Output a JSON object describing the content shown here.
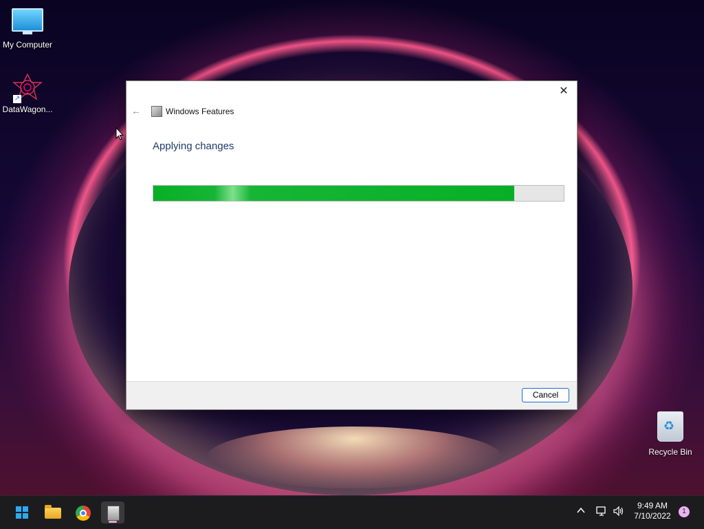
{
  "desktop": {
    "icons": [
      {
        "label": "My Computer"
      },
      {
        "label": "DataWagon..."
      },
      {
        "label": "Recycle Bin"
      }
    ]
  },
  "dialog": {
    "title": "Windows Features",
    "heading": "Applying changes",
    "progress_percent": 88,
    "cancel_label": "Cancel",
    "close_glyph": "✕",
    "back_glyph": "←"
  },
  "taskbar": {
    "apps": [
      {
        "icon": "start-icon"
      },
      {
        "icon": "file-explorer-icon"
      },
      {
        "icon": "chrome-icon"
      },
      {
        "icon": "windows-features-icon",
        "active": true
      }
    ],
    "tray": {
      "chevron": "^",
      "time": "9:49 AM",
      "date": "7/10/2022",
      "notification_count": "1"
    }
  },
  "colors": {
    "progress": "#06b025",
    "heading": "#1e3a66",
    "accent": "#1b6ccf"
  }
}
